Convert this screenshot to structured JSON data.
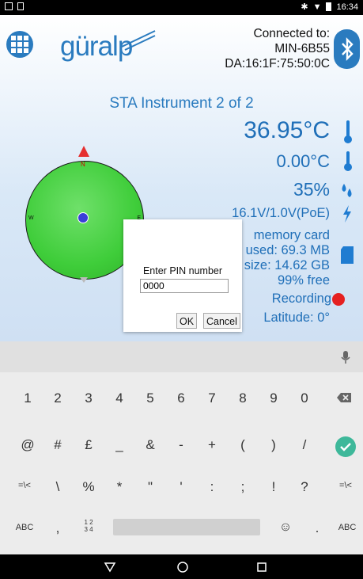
{
  "status_bar": {
    "time": "16:34",
    "left_icons": [
      "image-icon",
      "sim-icon"
    ],
    "right_icons": [
      "bluetooth-icon",
      "wifi-icon",
      "battery-icon"
    ]
  },
  "header": {
    "logo_text": "güralp",
    "connection": {
      "label": "Connected to:",
      "device": "MIN-6B55",
      "address": "DA:16:1F:75:50:0C"
    }
  },
  "title": "STA Instrument 2 of 2",
  "readings": {
    "temp1": "36.95°C",
    "temp2": "0.00°C",
    "humidity": "35%",
    "power": "16.1V/1.0V(PoE)",
    "memory_label": "memory card",
    "memory_used": "used: 69.3 MB",
    "memory_size": "size: 14.62 GB",
    "memory_free": "99% free",
    "recording": "Recording",
    "latitude": "Latitude: 0°"
  },
  "compass": {
    "n": "N",
    "w": "W",
    "e": "E"
  },
  "dialog": {
    "label": "Enter PIN number",
    "value": "0000",
    "ok": "OK",
    "cancel": "Cancel"
  },
  "keyboard": {
    "row1": [
      "1",
      "2",
      "3",
      "4",
      "5",
      "6",
      "7",
      "8",
      "9",
      "0"
    ],
    "row2": [
      "@",
      "#",
      "£",
      "_",
      "&",
      "-",
      "+",
      "(",
      ")",
      "/"
    ],
    "row3": [
      "=\\<",
      "\\",
      "%",
      "*",
      "\"",
      "'",
      ":",
      ";",
      "!",
      "?",
      "=\\<"
    ],
    "row4_left": "ABC",
    "row4_comma": ",",
    "row4_num": "1 2 3 4",
    "row4_period": ".",
    "row4_right": "ABC"
  },
  "colors": {
    "accent": "#2a7bbf",
    "value_blue": "#1f6fb8",
    "recording_red": "#e52020",
    "compass_green": "#3fcd3a"
  }
}
